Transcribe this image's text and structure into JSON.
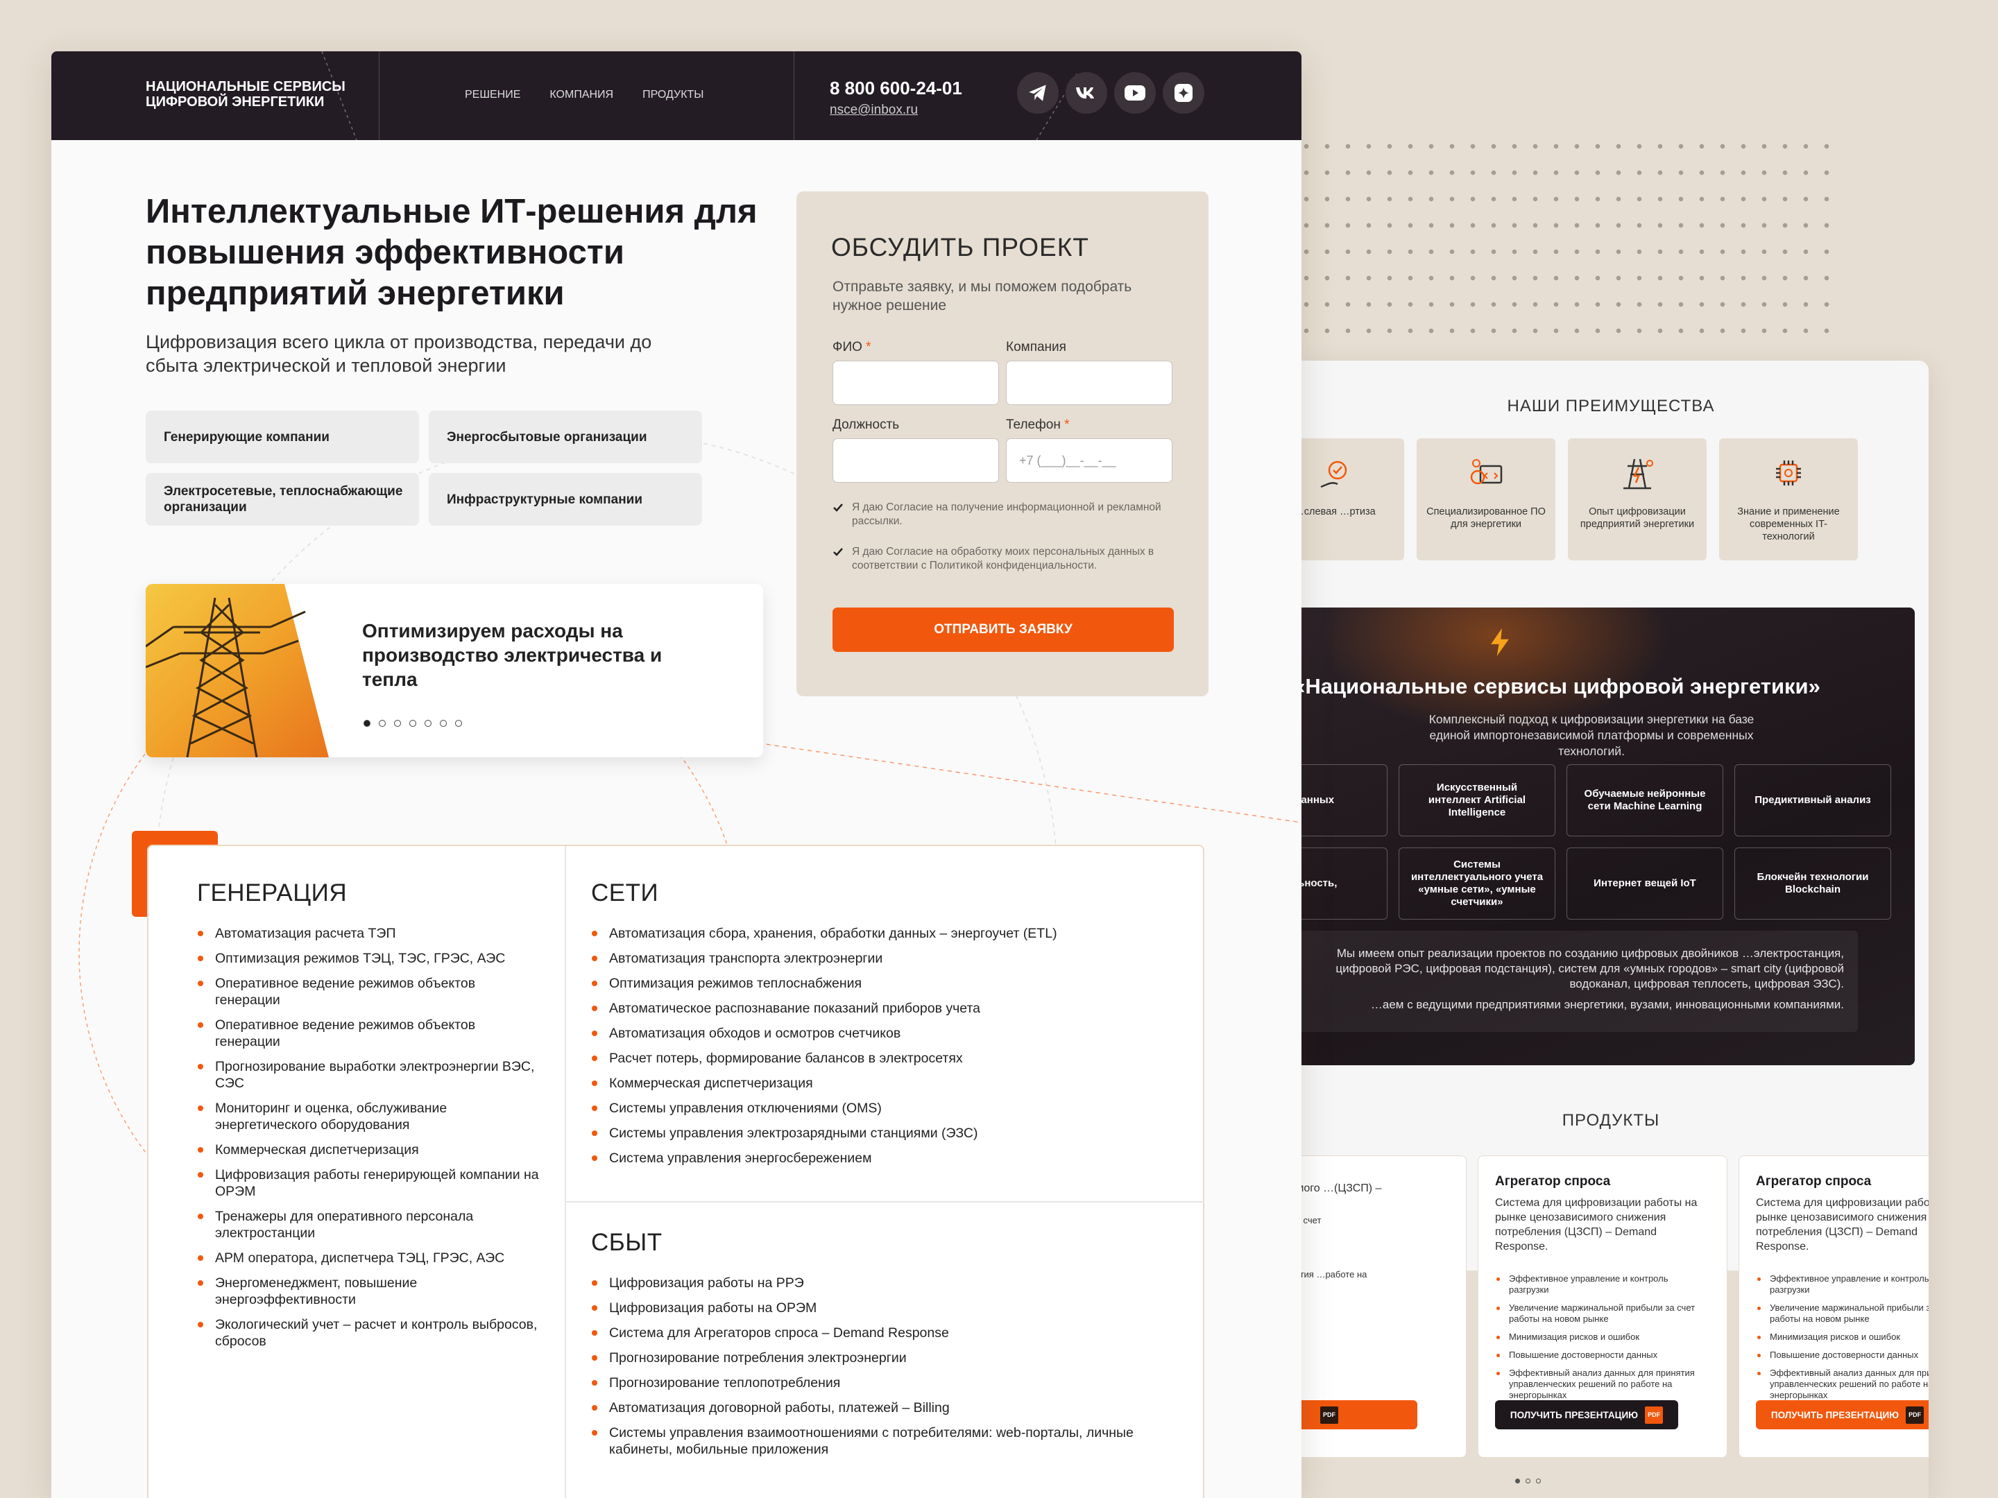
{
  "colors": {
    "accent": "#f2580d",
    "dark": "#231c24",
    "beige": "#e6ded2"
  },
  "header": {
    "logo_line1": "Национальные сервисы",
    "logo_line2": "цифровой энергетики",
    "nav": [
      "Решение",
      "Компания",
      "Продукты"
    ],
    "phone": "8 800 600-24-01",
    "email": "nsce@inbox.ru",
    "socials": [
      "telegram-icon",
      "vk-icon",
      "youtube-icon",
      "messenger-icon"
    ]
  },
  "hero": {
    "title": "Интеллектуальные ИТ-решения для повышения эффективности предприятий энергетики",
    "subtitle": "Цифровизация всего цикла от производства, передачи до сбыта электрической и тепловой энергии",
    "chips": [
      "Генерирующие компании",
      "Энергосбытовые организации",
      "Электросетевые, теплоснабжающие организации",
      "Инфраструктурные компании"
    ],
    "slide": {
      "title": "Оптимизируем расходы на производство электричества и тепла",
      "total": 7,
      "active": 1
    }
  },
  "form": {
    "title": "Обсудить проект",
    "note": "Отправьте заявку, и мы поможем подобрать нужное решение",
    "fio_label": "ФИО",
    "company_label": "Компания",
    "position_label": "Должность",
    "phone_label": "Телефон",
    "required_mark": "*",
    "phone_placeholder": "+7 (___)__-__-__",
    "consent1": "Я даю Согласие на получение информационной и рекламной рассылки.",
    "consent2": "Я даю Согласие на обработку моих персональных данных в соответствии с Политикой конфиденциальности.",
    "submit": "Отправить заявку"
  },
  "categories": {
    "generation": {
      "title": "Генерация",
      "items": [
        "Автоматизация расчета ТЭП",
        "Оптимизация режимов ТЭЦ, ТЭС, ГРЭС, АЭС",
        "Оперативное ведение режимов объектов генерации",
        "Оперативное ведение режимов объектов генерации",
        "Прогнозирование выработки электроэнергии ВЭС, СЭС",
        "Мониторинг и оценка, обслуживание энергетического оборудования",
        "Коммерческая диспетчеризация",
        "Цифровизация работы генерирующей компании на ОРЭМ",
        "Тренажеры для оперативного персонала электростанции",
        "АРМ оператора, диспетчера ТЭЦ, ГРЭС, АЭС",
        "Энергоменеджмент, повышение энергоэффективности",
        "Экологический учет – расчет и контроль выбросов, сбросов"
      ]
    },
    "networks": {
      "title": "Сети",
      "items": [
        "Автоматизация сбора, хранения, обработки данных – энергоучет (ETL)",
        "Автоматизация транспорта электроэнергии",
        "Оптимизация режимов теплоснабжения",
        "Автоматическое распознавание показаний приборов учета",
        "Автоматизация обходов и осмотров счетчиков",
        "Расчет потерь, формирование балансов в электросетях",
        "Коммерческая диспетчеризация",
        "Системы управления отключениями (OMS)",
        "Системы управления электрозарядными станциями (ЭЗС)",
        "Система управления энергосбережением"
      ]
    },
    "sales": {
      "title": "Сбыт",
      "items": [
        "Цифровизация работы на РРЭ",
        "Цифровизация работы на ОРЭМ",
        "Система для Агрегаторов спроса – Demand Response",
        "Прогнозирование потребления электроэнергии",
        "Прогнозирование теплопотребления",
        "Автоматизация договорной работы, платежей – Billing",
        "Системы управления взаимоотношениями с потребителями: web-порталы, личные кабинеты, мобильные приложения"
      ]
    }
  },
  "back_page": {
    "advantages_title": "Наши преимущества",
    "advantages": [
      {
        "label": "…слевая …ртиза",
        "icon": "hand-check-icon"
      },
      {
        "label": "Специализированное ПО для энергетики",
        "icon": "software-gear-icon"
      },
      {
        "label": "Опыт цифровизации предприятий энергетики",
        "icon": "power-tower-icon"
      },
      {
        "label": "Знание и применение современных IT-технологий",
        "icon": "chip-icon"
      }
    ],
    "platform_title": "«Национальные сервисы цифровой энергетики»",
    "platform_lead": "Комплексный подход к цифровизации энергетики на базе единой импортонезависимой платформы и современных технологий.",
    "tech": [
      "…данных",
      "Искусственный интеллект Artificial Intelligence",
      "Обучаемые нейронные сети Machine Learning",
      "Предиктивный анализ",
      "…льность,",
      "Системы интеллектуального учета «умные сети», «умные счетчики»",
      "Интернет вещей IoT",
      "Блокчейн технологии Blockchain"
    ],
    "experience_1": "Мы имеем опыт реализации проектов по созданию цифровых двойников …электростанция, цифровой РЭС, цифровая подстанция), систем для «умных городов» – smart city (цифровой водоканал, цифровая теплосеть, цифровая ЭЗС).",
    "experience_2": "…аем с ведущими предприятиями энергетики, вузами, инновационными компаниями.",
    "products_title": "Продукты",
    "products": [
      {
        "title": "",
        "desc": "…ации …симого …(ЦЗСП) –",
        "bullets": [
          "",
          "…рибыли за счет",
          "…бок",
          "…данных",
          "…для принятия …работе на"
        ],
        "button": "",
        "pdf": "PDF",
        "style": "or"
      },
      {
        "title": "Агрегатор спроса",
        "desc": "Система для цифровизации работы на рынке ценозависимого снижения потребления (ЦЗСП) – Demand Response.",
        "bullets": [
          "Эффективное управление и контроль разгрузки",
          "Увеличение маржинальной прибыли за счет работы на новом рынке",
          "Минимизация рисков и ошибок",
          "Повышение достоверности данных",
          "Эффективный анализ данных для принятия управленческих решений по работе на энергорынках"
        ],
        "button": "Получить презентацию",
        "pdf": "PDF",
        "style": "dk"
      },
      {
        "title": "Агрегатор спроса",
        "desc": "Система для цифровизации работы на рынке ценозависимого снижения потребления (ЦЗСП) – Demand Response.",
        "bullets": [
          "Эффективное управление и контроль разгрузки",
          "Увеличение маржинальной прибыли за счет работы на новом рынке",
          "Минимизация рисков и ошибок",
          "Повышение достоверности данных",
          "Эффективный анализ данных для принятия управленческих решений по работе на энергорынках"
        ],
        "button": "Получить презентацию",
        "pdf": "PDF",
        "style": "or"
      }
    ],
    "pager": {
      "total": 3,
      "active": 1
    }
  }
}
